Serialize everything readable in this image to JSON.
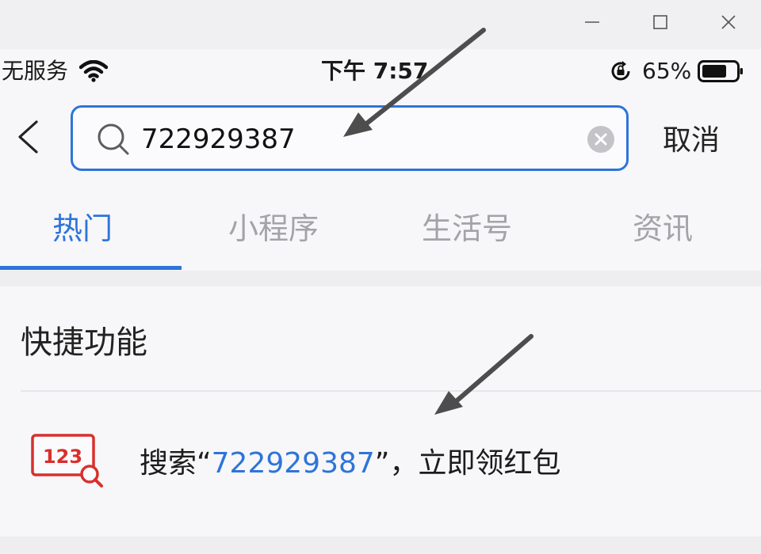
{
  "window": {
    "controls": [
      "minimize-icon",
      "maximize-icon",
      "close-icon"
    ]
  },
  "status_bar": {
    "carrier": "无服务",
    "time": "下午 7:57",
    "battery_percent": "65%",
    "icons": [
      "wifi-icon",
      "rotation-lock-icon",
      "battery-icon"
    ]
  },
  "search": {
    "query": "722929387",
    "cancel_label": "取消"
  },
  "tabs": [
    {
      "label": "热门",
      "active": true
    },
    {
      "label": "小程序",
      "active": false
    },
    {
      "label": "生活号",
      "active": false
    },
    {
      "label": "资讯",
      "active": false
    }
  ],
  "quick_functions": {
    "title": "快捷功能",
    "item": {
      "icon_text": "123",
      "prefix": "搜索“",
      "highlight": "722929387",
      "suffix": "”，立即领红包"
    }
  },
  "colors": {
    "accent": "#2e74d9",
    "icon_red": "#d9302c",
    "annotation_arrow": "#4d4d4d"
  }
}
